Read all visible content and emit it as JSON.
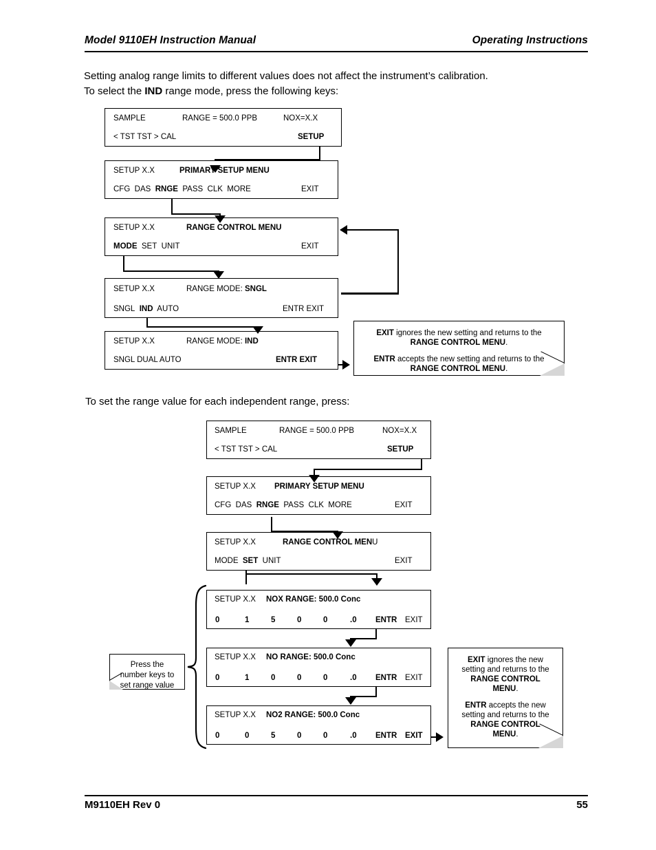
{
  "header": {
    "left": "Model 9110EH Instruction Manual",
    "right": "Operating Instructions"
  },
  "footer": {
    "left": "M9110EH Rev 0",
    "page_number": "55"
  },
  "paragraphs": {
    "intro_line1": "Setting analog range limits to different values does not affect the instrument’s calibration.",
    "intro_line2_pre": "To select the ",
    "intro_line2_bold": "IND",
    "intro_line2_post": " range mode, press the following keys:",
    "second": "To set the range value for each independent range, press:"
  },
  "diagram1": {
    "screens": [
      {
        "name": "sample-screen",
        "row1": [
          "SAMPLE",
          "RANGE = 500.0 PPB",
          "NOX=X.X"
        ],
        "row2_left": "< TST  TST >  CAL",
        "row2_right": "SETUP"
      },
      {
        "name": "primary-setup-menu-screen",
        "row1_left": "SETUP X.X",
        "row1_title": "PRIMARY SETUP MENU",
        "row2_left": "CFG  DAS  RNGE  PASS  CLK  MORE",
        "row2_right": "EXIT",
        "row2_highlight": "RNGE"
      },
      {
        "name": "range-control-menu-screen",
        "row1_left": "SETUP X.X",
        "row1_title": "RANGE CONTROL MENU",
        "row2_left": "MODE  SET  UNIT",
        "row2_right": "EXIT",
        "row2_highlight": "MODE"
      },
      {
        "name": "range-mode-sngl-screen",
        "row1_left": "SETUP X.X",
        "row1_title_pre": "RANGE MODE: ",
        "row1_title_bold": "SNGL",
        "row2_left": "SNGL  IND  AUTO",
        "row2_right": "ENTR  EXIT",
        "row2_highlight": "IND"
      },
      {
        "name": "range-mode-ind-screen",
        "row1_left": "SETUP X.X",
        "row1_title_pre": "RANGE MODE: ",
        "row1_title_bold": "IND",
        "row2_left": "SNGL  DUAL  AUTO",
        "row2_right": "ENTR  EXIT"
      }
    ],
    "note": {
      "p1_bold": "EXIT",
      "p1_text": " ignores the new setting and returns to the ",
      "p1_bold2": "RANGE CONTROL MENU",
      "p1_end": ".",
      "p2_bold": "ENTR",
      "p2_text": " accepts the new setting and returns to the ",
      "p2_bold2": "RANGE CONTROL MENU",
      "p2_end": "."
    }
  },
  "diagram2": {
    "screens": [
      {
        "name": "sample-screen",
        "row1": [
          "SAMPLE",
          "RANGE = 500.0 PPB",
          "NOX=X.X"
        ],
        "row2_left": "< TST  TST >  CAL",
        "row2_right": "SETUP"
      },
      {
        "name": "primary-setup-menu-screen",
        "row1_left": "SETUP X.X",
        "row1_title": "PRIMARY SETUP MENU",
        "row2_left": "CFG  DAS  RNGE  PASS  CLK  MORE",
        "row2_right": "EXIT",
        "row2_highlight": "RNGE"
      },
      {
        "name": "range-control-menu-screen",
        "row1_left": "SETUP X.X",
        "row1_title_bold": "RANGE CONTROL MEN",
        "row1_title_tail": "U",
        "row2_left": "MODE  SET  UNIT",
        "row2_right": "EXIT",
        "row2_highlight": "SET"
      }
    ],
    "range_screens": [
      {
        "name": "nox-range-screen",
        "row1_left": "SETUP X.X",
        "row1_title": "NOX RANGE: 500.0 Conc",
        "digits": [
          "0",
          "1",
          "5",
          "0",
          "0",
          ".0"
        ],
        "entr": "ENTR",
        "exit": "EXIT",
        "entr_bold": true,
        "exit_bold": false
      },
      {
        "name": "no-range-screen",
        "row1_left": "SETUP X.X",
        "row1_title": "NO RANGE: 500.0 Conc",
        "digits": [
          "0",
          "1",
          "0",
          "0",
          "0",
          ".0"
        ],
        "entr": "ENTR",
        "exit": "EXIT",
        "entr_bold": true,
        "exit_bold": false
      },
      {
        "name": "no2-range-screen",
        "row1_left": "SETUP X.X",
        "row1_title": "NO2 RANGE: 500.0 Conc",
        "digits": [
          "0",
          "0",
          "5",
          "0",
          "0",
          ".0"
        ],
        "entr": "ENTR",
        "exit": "EXIT",
        "entr_bold": true,
        "exit_bold": true
      }
    ],
    "keypad_note": {
      "line1": "Press the",
      "line2": "number keys to",
      "line3": "set range value"
    },
    "note": {
      "p1_bold": "EXIT",
      "p1_text": " ignores the new",
      "p1_line2": "setting and returns to the",
      "p1_bold2_line1": "RANGE CONTROL",
      "p1_bold2_line2": "MENU",
      "p1_end": ".",
      "p2_bold": "ENTR",
      "p2_text": " accepts the new",
      "p2_line2": "setting and returns to the",
      "p2_bold2_line1": "RANGE CONTROL",
      "p2_bold2_line2": "MENU",
      "p2_end": "."
    }
  }
}
